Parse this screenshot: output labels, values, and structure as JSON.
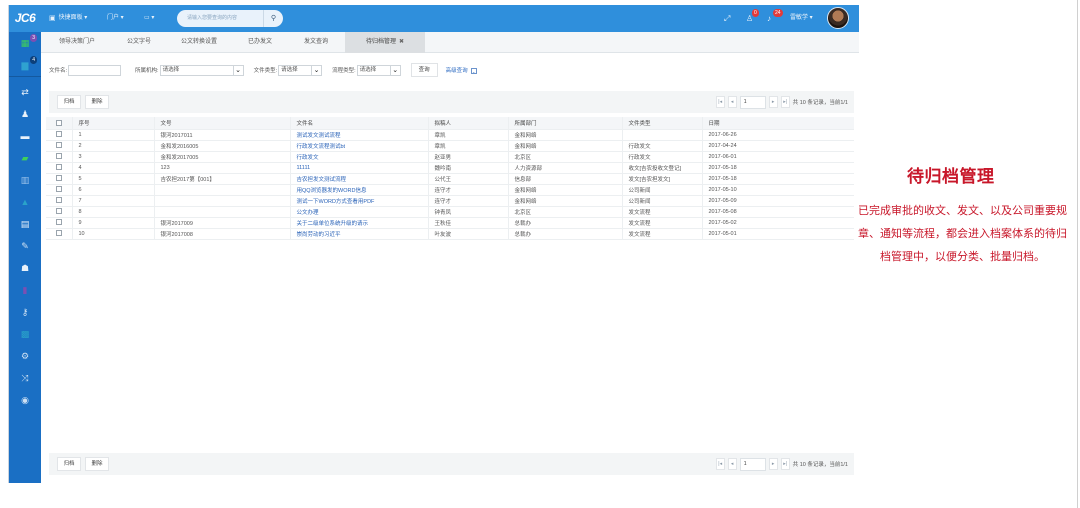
{
  "topbar": {
    "logo": "JC6",
    "nav": [
      {
        "icon": "dashboard-icon",
        "label": "快捷面板 ▾"
      },
      {
        "icon": "",
        "label": "门户 ▾"
      },
      {
        "icon": "monitor-icon",
        "label": "▭ ▾"
      }
    ],
    "search_placeholder": "请输入您要查询的内容",
    "search_icon": "🔍",
    "icons": {
      "expand": "⤢",
      "contacts": "♙",
      "bell": "♫"
    },
    "contacts_badge": "0",
    "bell_badge": "24",
    "user_name": "雷敏学 ▾"
  },
  "sidebar": {
    "top_items": [
      {
        "icon": "apps-grid-icon",
        "glyph": "▦",
        "badge": "3",
        "badge_color": "#7b4fb3",
        "color": "#3fcf5a"
      },
      {
        "icon": "folder-icon",
        "glyph": "▆",
        "badge": "4",
        "badge_color": "#0c3f7a",
        "color": "#2fa2d0"
      }
    ],
    "items": [
      {
        "icon": "exchange-icon",
        "glyph": "⇄",
        "color": "#e8f1fa"
      },
      {
        "icon": "user-icon",
        "glyph": "♟",
        "color": "#e8f1fa"
      },
      {
        "icon": "comment-icon",
        "glyph": "▬",
        "color": "#e8f1fa"
      },
      {
        "icon": "briefcase-icon",
        "glyph": "▰",
        "color": "#3fcf5a"
      },
      {
        "icon": "book-icon",
        "glyph": "▥",
        "color": "#9cc3ea"
      },
      {
        "icon": "graduation-cap-icon",
        "glyph": "▲",
        "color": "#2aa3c9"
      },
      {
        "icon": "archive-icon",
        "glyph": "▤",
        "color": "#e8f1fa"
      },
      {
        "icon": "edit-icon",
        "glyph": "✎",
        "color": "#cfe1f3"
      },
      {
        "icon": "users-icon",
        "glyph": "☗",
        "color": "#e8f1fa"
      },
      {
        "icon": "bar-chart-icon",
        "glyph": "▮",
        "color": "#7b4fb3"
      },
      {
        "icon": "key-icon",
        "glyph": "⚷",
        "color": "#cfe1f3"
      },
      {
        "icon": "calendar-icon",
        "glyph": "▩",
        "color": "#2aa3c9"
      },
      {
        "icon": "settings-icon",
        "glyph": "⚙",
        "color": "#cfe1f3"
      },
      {
        "icon": "shuffle-icon",
        "glyph": "⤨",
        "color": "#cfe1f3"
      },
      {
        "icon": "eye-icon",
        "glyph": "◉",
        "color": "#cfe1f3"
      }
    ]
  },
  "tabs": [
    {
      "label": "领导决策门户",
      "active": false
    },
    {
      "label": "公文字号",
      "active": false
    },
    {
      "label": "公文转换设置",
      "active": false
    },
    {
      "label": "已办发文",
      "active": false
    },
    {
      "label": "发文查询",
      "active": false
    },
    {
      "label": "待归档管理",
      "active": true,
      "close": "✖"
    }
  ],
  "filters": {
    "file_name_label": "文件名:",
    "file_name_value": "",
    "org_label": "所属机构:",
    "org_value": "请选择",
    "file_type_label": "文件类型:",
    "file_type_value": "请选择",
    "flow_type_label": "流程类型:",
    "flow_type_value": "请选择",
    "query_button": "查询",
    "advanced_query": "高级查询"
  },
  "toolbar": {
    "archive_button": "归档",
    "delete_button": "删除",
    "page_input": "1",
    "pager_text": "共 10 条记录，当前1/1",
    "first": "|◂",
    "prev": "◂",
    "next": "▸",
    "last": "▸|"
  },
  "table": {
    "headers": [
      "",
      "序号",
      "文号",
      "文件名",
      "拟稿人",
      "所属部门",
      "文件类型",
      "日期"
    ],
    "rows": [
      [
        "1",
        "银河2017011",
        "测试发文测试流程",
        "章凯",
        "金和网络",
        "",
        "2017-06-26"
      ],
      [
        "2",
        "金和发2016005",
        "行政发文流程测试bt",
        "章凯",
        "金和网络",
        "行政发文",
        "2017-04-24"
      ],
      [
        "3",
        "金和发2017005",
        "行政发文",
        "赵亚男",
        "北京区",
        "行政发文",
        "2017-06-01"
      ],
      [
        "4",
        "123",
        "11111",
        "魏吟南",
        "人力资源部",
        "收文[吉农投收文登记]",
        "2017-05-18"
      ],
      [
        "5",
        "吉农担2017第【001】",
        "吉农担发文测试流程",
        "公代王",
        "信息部",
        "发文[吉农担发文]",
        "2017-05-18"
      ],
      [
        "6",
        "",
        "用QQ浏览器发的WORD信息",
        "连守才",
        "金和网络",
        "公司新闻",
        "2017-05-10"
      ],
      [
        "7",
        "",
        "测试一下WORD方式查看用PDF",
        "连守才",
        "金和网络",
        "公司新闻",
        "2017-05-09"
      ],
      [
        "8",
        "",
        "公文办理",
        "钟青凤",
        "北京区",
        "发文流程",
        "2017-05-08"
      ],
      [
        "9",
        "银河2017009",
        "关于二级单位系统升级的请示",
        "王秋佳",
        "总裁办",
        "发文流程",
        "2017-05-02"
      ],
      [
        "10",
        "银河2017008",
        "崇尚劳动的习近平",
        "叶友波",
        "总裁办",
        "发文流程",
        "2017-05-01"
      ]
    ]
  },
  "annotation": {
    "title": "待归档管理",
    "body": "已完成审批的收文、发文、以及公司重要规章、通知等流程，都会进入档案体系的待归档管理中，以便分类、批量归档。"
  }
}
